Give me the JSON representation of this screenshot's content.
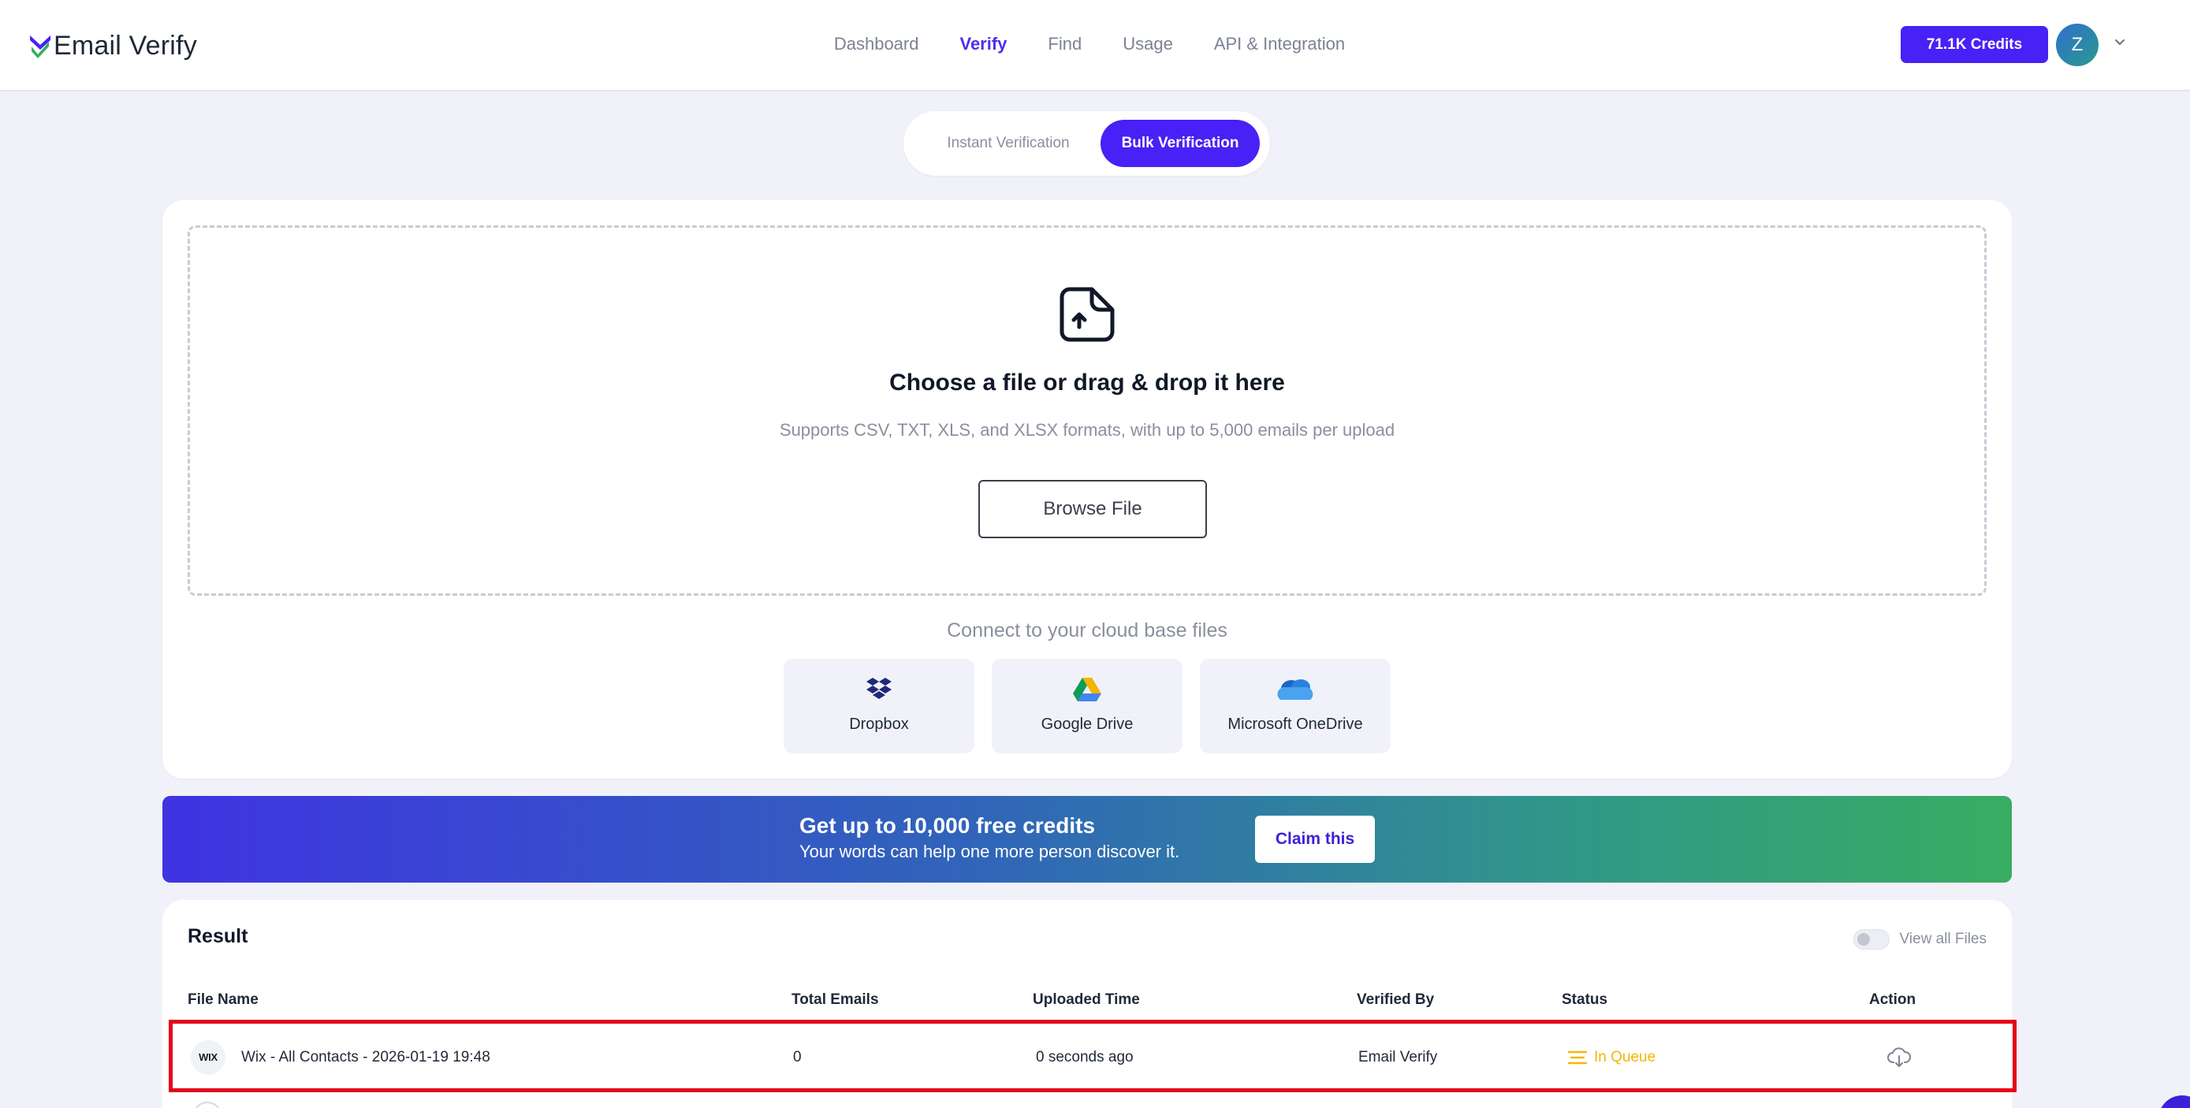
{
  "header": {
    "logo_text": "Email Verify",
    "nav": [
      "Dashboard",
      "Verify",
      "Find",
      "Usage",
      "API & Integration"
    ],
    "active_nav": "Verify",
    "credits_label": "71.1K Credits",
    "avatar_initial": "Z"
  },
  "segment": {
    "instant": "Instant Verification",
    "bulk": "Bulk Verification",
    "selected": "Bulk Verification"
  },
  "upload": {
    "title": "Choose a file or drag & drop it here",
    "subtitle": "Supports CSV, TXT, XLS, and XLSX formats, with up to 5,000 emails per upload",
    "browse_label": "Browse File",
    "cloud_title": "Connect to your cloud base files",
    "cloud": [
      "Dropbox",
      "Google Drive",
      "Microsoft OneDrive"
    ]
  },
  "promo": {
    "title": "Get up to 10,000 free credits",
    "subtitle": "Your words can help one more person discover it.",
    "button": "Claim this"
  },
  "result": {
    "title": "Result",
    "toggle_label": "View all Files",
    "columns": [
      "File Name",
      "Total Emails",
      "Uploaded Time",
      "Verified By",
      "Status",
      "Action"
    ],
    "rows": [
      {
        "badge": "WIX",
        "file_name": "Wix - All Contacts - 2026-01-19 19:48",
        "total_emails": "0",
        "uploaded": "0 seconds ago",
        "verified_by": "Email Verify",
        "status": "In Queue"
      }
    ]
  },
  "colors": {
    "accent": "#4721f5",
    "status_queue": "#f2b705",
    "highlight": "#e3061a"
  }
}
